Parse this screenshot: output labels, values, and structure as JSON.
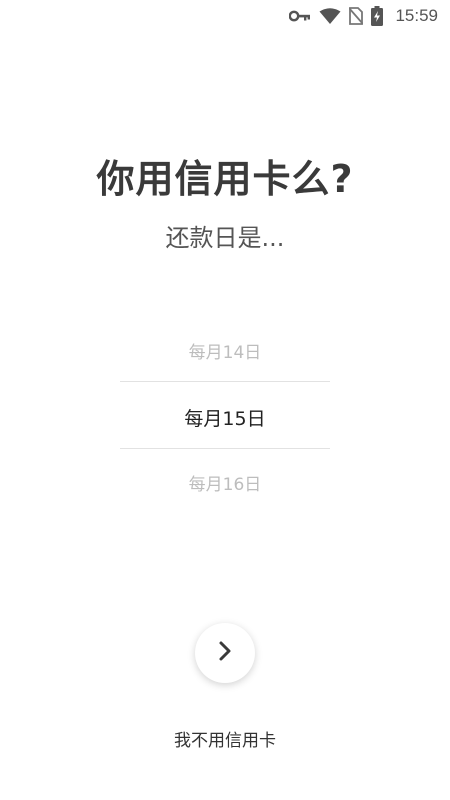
{
  "status_bar": {
    "time": "15:59",
    "icons": [
      "key-icon",
      "wifi-icon",
      "no-sim-icon",
      "battery-charging-icon"
    ]
  },
  "main": {
    "title": "你用信用卡么?",
    "subtitle": "还款日是...",
    "picker": {
      "prev": "每月14日",
      "current": "每月15日",
      "next": "每月16日"
    },
    "next_button_icon": "chevron-right-icon",
    "no_card_label": "我不用信用卡"
  },
  "colors": {
    "background": "#ffffff",
    "title": "#3a3a3a",
    "picker_inactive": "#bdbdbd",
    "picker_active": "#222222",
    "divider": "#e2e2e2"
  }
}
